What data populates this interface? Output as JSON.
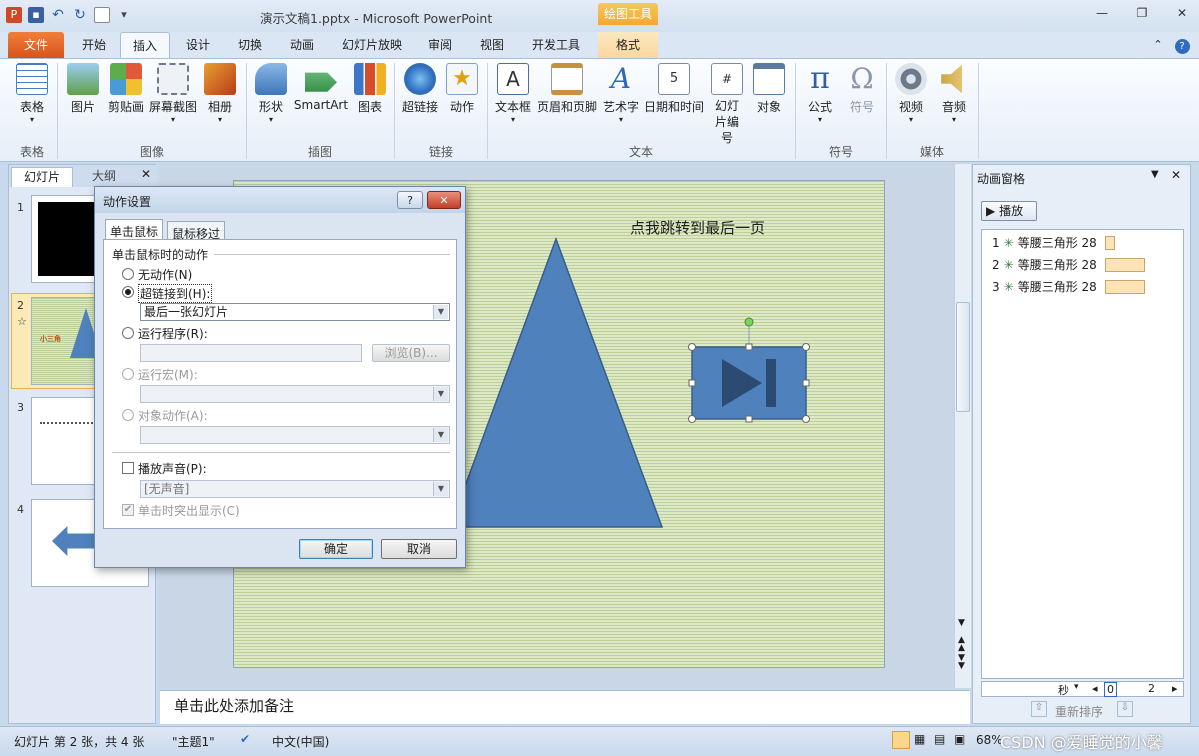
{
  "window": {
    "title": "演示文稿1.pptx - Microsoft PowerPoint",
    "context_group": "绘图工具",
    "controls": [
      "minimize",
      "restore",
      "close"
    ]
  },
  "qat": {
    "icons": [
      "powerpoint-logo-icon",
      "save-icon",
      "undo-icon",
      "redo-icon",
      "new-icon"
    ]
  },
  "tabs": {
    "file": "文件",
    "items": [
      "开始",
      "插入",
      "设计",
      "切换",
      "动画",
      "幻灯片放映",
      "审阅",
      "视图",
      "开发工具"
    ],
    "format": "格式",
    "active": "插入"
  },
  "ribbon": {
    "buttons": [
      {
        "label": "表格",
        "icon": "table-icon",
        "color": "#4a7cc0"
      },
      {
        "label": "图片",
        "icon": "picture-icon",
        "color": "#5a9ad6"
      },
      {
        "label": "剪贴画",
        "icon": "clipart-icon",
        "color": "#d8a030"
      },
      {
        "label": "屏幕截图",
        "icon": "screenshot-icon",
        "color": "#8a98aa"
      },
      {
        "label": "相册",
        "icon": "album-icon",
        "color": "#c05020"
      },
      {
        "label": "形状",
        "icon": "shapes-icon",
        "color": "#5a8ec8"
      },
      {
        "label": "SmartArt",
        "icon": "smartart-icon",
        "color": "#3f9a54"
      },
      {
        "label": "图表",
        "icon": "chart-icon",
        "color": "#d84c2a"
      },
      {
        "label": "超链接",
        "icon": "hyperlink-icon",
        "color": "#3e8a3e"
      },
      {
        "label": "动作",
        "icon": "action-icon",
        "color": "#e0b020"
      },
      {
        "label": "文本框",
        "icon": "textbox-icon",
        "color": "#4a6ea0"
      },
      {
        "label": "页眉和页脚",
        "icon": "header-footer-icon",
        "color": "#c89040"
      },
      {
        "label": "艺术字",
        "icon": "wordart-icon",
        "color": "#2f68b8"
      },
      {
        "label": "日期和时间",
        "icon": "datetime-icon",
        "color": "#7a8aa0"
      },
      {
        "label": "幻灯片编号",
        "icon": "slide-number-icon",
        "color": "#7a8aa0"
      },
      {
        "label": "对象",
        "icon": "object-icon",
        "color": "#5a7aa0"
      },
      {
        "label": "公式",
        "icon": "equation-icon",
        "color": "#2f5fa8"
      },
      {
        "label": "符号",
        "icon": "symbol-icon",
        "color": "#8a96a8"
      },
      {
        "label": "视频",
        "icon": "video-icon",
        "color": "#6a7a8a"
      },
      {
        "label": "音频",
        "icon": "audio-icon",
        "color": "#c8a040"
      }
    ],
    "groups": [
      "表格",
      "图像",
      "插图",
      "链接",
      "文本",
      "符号",
      "媒体"
    ]
  },
  "left_panel": {
    "tabs": [
      "幻灯片",
      "大纲"
    ],
    "close_icon": "close-icon",
    "slides": [
      {
        "number": "1"
      },
      {
        "number": "2",
        "star": "☆",
        "text": "小三角"
      },
      {
        "number": "3"
      },
      {
        "number": "4"
      }
    ]
  },
  "slide": {
    "caption": "点我跳转到最后一页"
  },
  "notes": {
    "placeholder": "单击此处添加备注"
  },
  "anim_pane": {
    "title": "动画窗格",
    "play": "播放",
    "items": [
      {
        "num": "1",
        "label": "等腰三角形 28"
      },
      {
        "num": "2",
        "label": "等腰三角形 28"
      },
      {
        "num": "3",
        "label": "等腰三角形 28"
      }
    ],
    "timeline_unit": "秒",
    "timeline_start": "0",
    "timeline_end": "2",
    "reorder": "重新排序"
  },
  "dialog": {
    "title": "动作设置",
    "help": "?",
    "close": "✕",
    "tabs": [
      "单击鼠标",
      "鼠标移过"
    ],
    "section": "单击鼠标时的动作",
    "options": {
      "none": "无动作(N)",
      "hyperlink": "超链接到(H):",
      "hyperlink_value": "最后一张幻灯片",
      "run_program": "运行程序(R):",
      "browse": "浏览(B)...",
      "run_macro": "运行宏(M):",
      "object_action": "对象动作(A):",
      "play_sound": "播放声音(P):",
      "sound_value": "[无声音]",
      "highlight": "单击时突出显示(C)"
    },
    "ok": "确定",
    "cancel": "取消"
  },
  "status": {
    "slide_info": "幻灯片 第 2 张，共 4 张",
    "theme": "\"主题1\"",
    "language": "中文(中国)",
    "zoom": "68%",
    "watermark": "CSDN @爱睡觉的小馨"
  }
}
